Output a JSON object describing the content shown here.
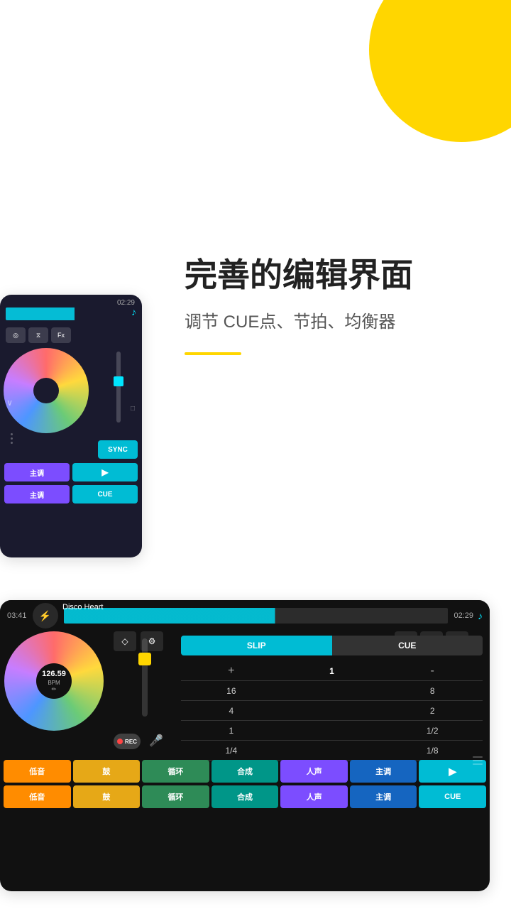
{
  "background": "#ffffff",
  "deco": {
    "circle_color": "#FFD600"
  },
  "text_section": {
    "main_title": "完善的编辑界面",
    "sub_title": "调节 CUE点、节拍、均衡器"
  },
  "device_top": {
    "time": "02:29",
    "sync_label": "SYNC",
    "pad_labels_row1": [
      "主调",
      "▶",
      "CUE"
    ],
    "pad_labels_row2": [
      "主调"
    ],
    "cue_label": "CUE"
  },
  "device_bottom": {
    "time_left": "03:41",
    "song_name": "Disco Heart",
    "time_right": "02:29",
    "bpm": "126.59",
    "bpm_label": "BPM",
    "slip_label": "SLIP",
    "cue_label": "CUE",
    "beat_rows": [
      {
        "left": "+",
        "center": "1",
        "right": "-"
      },
      {
        "left": "16",
        "center": "",
        "right": "8"
      },
      {
        "left": "4",
        "center": "",
        "right": "2"
      },
      {
        "left": "1",
        "center": "",
        "right": "1/2"
      },
      {
        "left": "1/4",
        "center": "",
        "right": "1/8"
      }
    ],
    "rec_label": "REC",
    "pads_row1": [
      "低音",
      "鼓",
      "循环",
      "合成",
      "人声",
      "主调",
      "▶"
    ],
    "pads_row2": [
      "低音",
      "鼓",
      "循环",
      "合成",
      "人声",
      "主调",
      "CUE"
    ]
  }
}
